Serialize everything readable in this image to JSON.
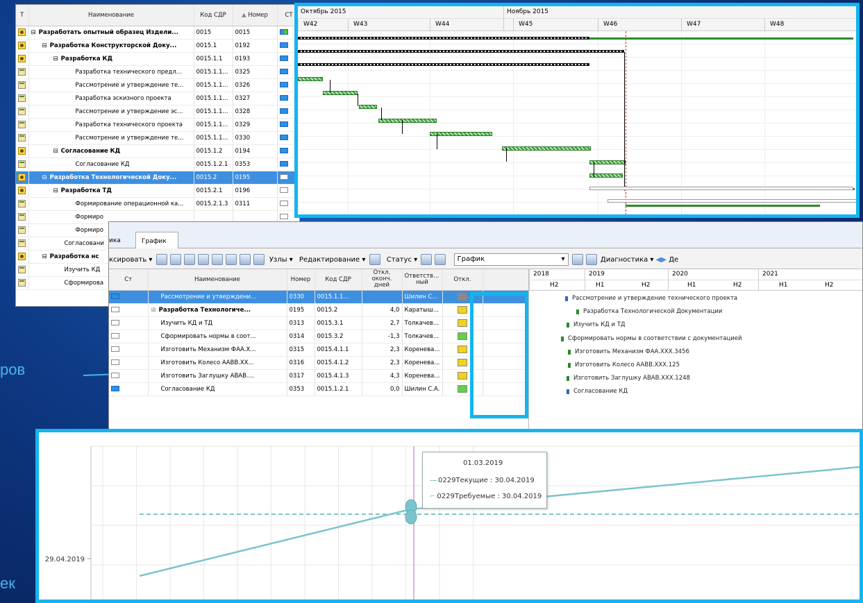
{
  "slide": {
    "left_text_1": "ров",
    "left_text_2": "ек"
  },
  "topleft": {
    "headers": [
      "Т",
      "Наименование",
      "Код СДР",
      "Номер",
      "СТ"
    ],
    "rows": [
      {
        "icon": "summary-icon",
        "indent": 0,
        "exp": "⊟",
        "name": "Разработать опытный образец Издели...",
        "code": "0015",
        "num": "0015",
        "bold": true,
        "st": "ml"
      },
      {
        "icon": "summary-icon",
        "indent": 1,
        "exp": "⊟",
        "name": "Разработка Конструкторской Доку...",
        "code": "0015.1",
        "num": "0192",
        "bold": true,
        "st": "bl"
      },
      {
        "icon": "summary-icon",
        "indent": 2,
        "exp": "⊟",
        "name": "Разработка КД",
        "code": "0015.1.1",
        "num": "0193",
        "bold": true,
        "st": "bl"
      },
      {
        "icon": "task-icon",
        "indent": 4,
        "exp": "",
        "name": "Разработка технического предл...",
        "code": "0015.1.1...",
        "num": "0325",
        "bold": false,
        "st": "bl"
      },
      {
        "icon": "task-icon",
        "indent": 4,
        "exp": "",
        "name": "Рассмотрение и утверждение те...",
        "code": "0015.1.1...",
        "num": "0326",
        "bold": false,
        "st": "bl"
      },
      {
        "icon": "task-icon",
        "indent": 4,
        "exp": "",
        "name": "Разработка эскизного проекта",
        "code": "0015.1.1...",
        "num": "0327",
        "bold": false,
        "st": "bl"
      },
      {
        "icon": "task-icon",
        "indent": 4,
        "exp": "",
        "name": "Рассмотрение и утверждение эс...",
        "code": "0015.1.1...",
        "num": "0328",
        "bold": false,
        "st": "bl"
      },
      {
        "icon": "task-icon",
        "indent": 4,
        "exp": "",
        "name": "Разработка технического проекта",
        "code": "0015.1.1...",
        "num": "0329",
        "bold": false,
        "st": "bl"
      },
      {
        "icon": "task-icon",
        "indent": 4,
        "exp": "",
        "name": "Рассмотрение и утверждение те...",
        "code": "0015.1.1...",
        "num": "0330",
        "bold": false,
        "st": "bl"
      },
      {
        "icon": "summary-icon",
        "indent": 2,
        "exp": "⊟",
        "name": "Согласование КД",
        "code": "0015.1.2",
        "num": "0194",
        "bold": true,
        "st": "bl"
      },
      {
        "icon": "task-icon",
        "indent": 4,
        "exp": "",
        "name": "Согласование КД",
        "code": "0015.1.2.1",
        "num": "0353",
        "bold": false,
        "st": "bl"
      },
      {
        "icon": "summary-icon",
        "indent": 1,
        "exp": "⊟",
        "name": "Разработка Технологической Доку...",
        "code": "0015.2",
        "num": "0195",
        "bold": true,
        "st": "",
        "sel": true
      },
      {
        "icon": "summary-icon",
        "indent": 2,
        "exp": "⊟",
        "name": "Разработка ТД",
        "code": "0015.2.1",
        "num": "0196",
        "bold": true,
        "st": ""
      },
      {
        "icon": "task-icon",
        "indent": 4,
        "exp": "",
        "name": "Формирование операционной ка...",
        "code": "0015.2.1.3",
        "num": "0311",
        "bold": false,
        "st": ""
      },
      {
        "icon": "task-icon",
        "indent": 4,
        "exp": "",
        "name": "Формиро",
        "code": "",
        "num": "",
        "bold": false,
        "st": ""
      },
      {
        "icon": "task-icon",
        "indent": 4,
        "exp": "",
        "name": "Формиро",
        "code": "",
        "num": "",
        "bold": false,
        "st": ""
      },
      {
        "icon": "task-icon",
        "indent": 3,
        "exp": "",
        "name": "Согласовани",
        "code": "",
        "num": "",
        "bold": false,
        "st": ""
      },
      {
        "icon": "summary-icon",
        "indent": 1,
        "exp": "⊟",
        "name": "Разработка нс",
        "code": "",
        "num": "",
        "bold": true,
        "st": ""
      },
      {
        "icon": "task-icon",
        "indent": 3,
        "exp": "",
        "name": "Изучить КД",
        "code": "",
        "num": "",
        "bold": false,
        "st": ""
      },
      {
        "icon": "task-icon",
        "indent": 3,
        "exp": "",
        "name": "Сформирова",
        "code": "",
        "num": "",
        "bold": false,
        "st": ""
      }
    ]
  },
  "gantt_top": {
    "months": [
      {
        "label": "Октябрь 2015"
      },
      {
        "label": "Ноябрь 2015"
      }
    ],
    "weeks": [
      "W42",
      "W43",
      "W44",
      "W45",
      "W46",
      "W47",
      "W48"
    ]
  },
  "mid": {
    "tabs": [
      "ика",
      "График"
    ],
    "toolbar": {
      "fix": "ксировать",
      "nodes": "Узлы",
      "edit": "Редактирование",
      "status": "Статус",
      "view_select": "График",
      "diag": "Диагностика",
      "de": "Де"
    },
    "headers": [
      "Ст",
      "Наименование",
      "Номер",
      "Код СДР",
      "Откл. оконч. дней",
      "Ответствен ный",
      "Откл."
    ],
    "rows": [
      {
        "name": "Рассмотрение и утверждени...",
        "num": "0330",
        "code": "0015.1.1...",
        "dev": "",
        "resp": "Шилин С...",
        "flag": "gray",
        "st": "bl",
        "sel": true,
        "exp": ""
      },
      {
        "name": "Разработка Технологиче...",
        "num": "0195",
        "code": "0015.2",
        "dev": "4,0",
        "resp": "Каратыш...",
        "flag": "yellow",
        "st": "",
        "bold": true,
        "exp": "⊞"
      },
      {
        "name": "Изучить КД и ТД",
        "num": "0313",
        "code": "0015.3.1",
        "dev": "2,7",
        "resp": "Толкачев...",
        "flag": "yellow",
        "st": "",
        "exp": ""
      },
      {
        "name": "Сформировать нормы в соот...",
        "num": "0314",
        "code": "0015.3.2",
        "dev": "-1,3",
        "resp": "Толкачев...",
        "flag": "green",
        "st": "",
        "exp": ""
      },
      {
        "name": "Изготовить Механизм ФАА.Х...",
        "num": "0315",
        "code": "0015.4.1.1",
        "dev": "2,3",
        "resp": "Коренева...",
        "flag": "yellow",
        "st": "",
        "exp": ""
      },
      {
        "name": "Изготовить Колесо ААВВ.ХХ...",
        "num": "0316",
        "code": "0015.4.1.2",
        "dev": "2,3",
        "resp": "Коренева...",
        "flag": "yellow",
        "st": "",
        "exp": ""
      },
      {
        "name": "Изготовить Заглушку АВАВ....",
        "num": "0317",
        "code": "0015.4.1.3",
        "dev": "4,3",
        "resp": "Коренева...",
        "flag": "yellow",
        "st": "",
        "exp": ""
      },
      {
        "name": "Согласование КД",
        "num": "0353",
        "code": "0015.1.2.1",
        "dev": "0,0",
        "resp": "Шилин С.А.",
        "flag": "green",
        "st": "bl",
        "exp": ""
      }
    ],
    "gantt_years": [
      "2018",
      "2019",
      "2020",
      "2021"
    ],
    "gantt_halves": [
      "H2",
      "H1",
      "H2",
      "H1",
      "H2",
      "H1",
      "H2"
    ],
    "gantt_labels": [
      "Рассмотрение и утверждение технического проекта",
      "Разработка Технологической Документации",
      "Изучить КД и ТД",
      "Сформировать нормы в соответствии с документацией",
      "Изготовить Механизм ФАА.XXX.3456",
      "Изготовить Колесо AABB.XXX.125",
      "Изготовить Заглушку ABAB.XXX.1248",
      "Согласование КД"
    ]
  },
  "chart_data": {
    "type": "line",
    "ytick": "29.04.2019",
    "tooltip": {
      "date": "01.03.2019",
      "line1": "0229Текущие : 30.04.2019",
      "line2": "0229Требуемые : 30.04.2019"
    },
    "series": [
      {
        "name": "0229Текущие",
        "style": "solid",
        "color": "#7cc4cc"
      },
      {
        "name": "0229Требуемые",
        "style": "dashed",
        "color": "#7cc4cc"
      }
    ]
  }
}
